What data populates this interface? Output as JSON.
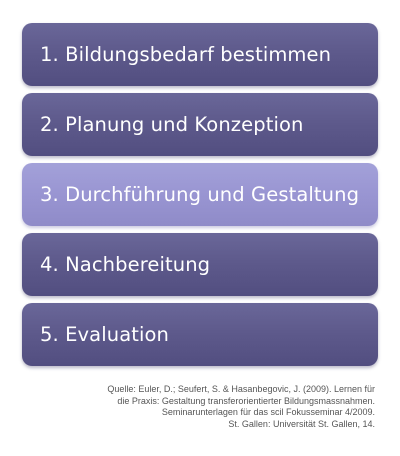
{
  "steps": [
    {
      "label": "1. Bildungsbedarf bestimmen",
      "highlighted": false
    },
    {
      "label": "2. Planung und Konzeption",
      "highlighted": false
    },
    {
      "label": "3. Durchführung und Gestaltung",
      "highlighted": true
    },
    {
      "label": "4. Nachbereitung",
      "highlighted": false
    },
    {
      "label": "5. Evaluation",
      "highlighted": false
    }
  ],
  "colors": {
    "box": "#5e5a8c",
    "box_highlight": "#9995d2",
    "text": "#ffffff",
    "source_text": "#555555"
  },
  "source": {
    "lines": [
      "Quelle: Euler, D.; Seufert, S. & Hasanbegovic, J. (2009). Lernen für",
      "die Praxis: Gestaltung transferorientierter Bildungsmassnahmen.",
      "Seminarunterlagen für das scil Fokusseminar 4/2009.",
      "St. Gallen: Universität St. Gallen, 14."
    ]
  }
}
